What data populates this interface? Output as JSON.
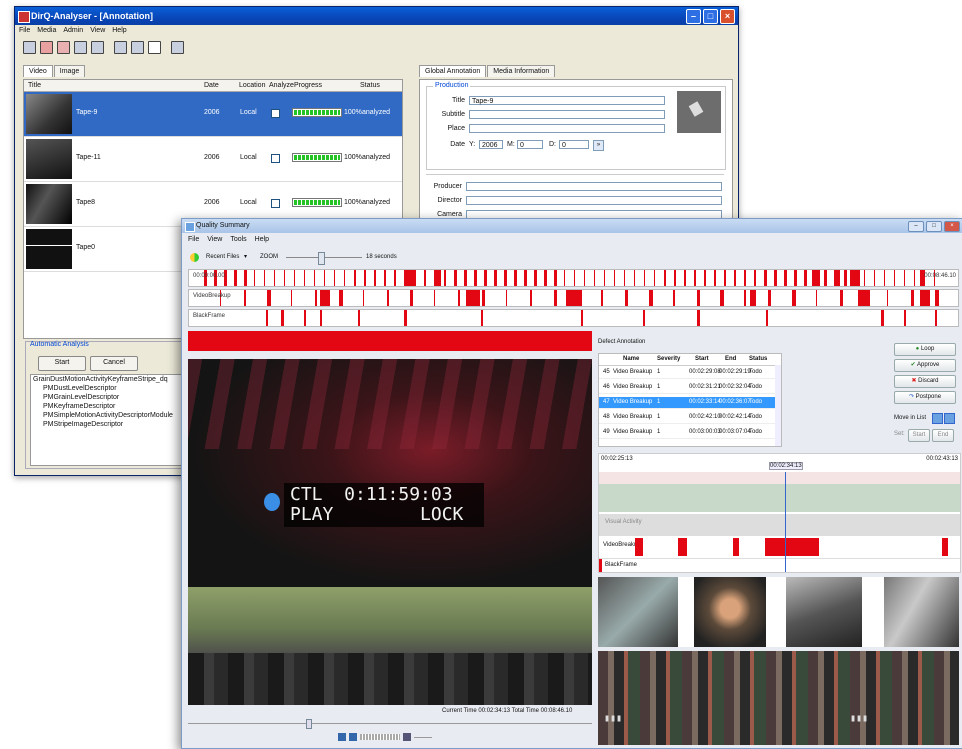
{
  "window_back": {
    "title": "DirQ-Analyser - [Annotation]",
    "menu": [
      "File",
      "Media",
      "Admin",
      "View",
      "Help"
    ],
    "left_tabs": [
      "Video",
      "Image"
    ],
    "columns": [
      "Title",
      "Date",
      "Location",
      "Analyze",
      "Progress",
      "Status"
    ],
    "rows": [
      {
        "title": "Tape-9",
        "date": "2006",
        "location": "Local",
        "progress_pct": 100,
        "progress_label": "100%",
        "status": "analyzed",
        "selected": true
      },
      {
        "title": "Tape-11",
        "date": "2006",
        "location": "Local",
        "progress_pct": 100,
        "progress_label": "100%",
        "status": "analyzed",
        "selected": false
      },
      {
        "title": "Tape8",
        "date": "2006",
        "location": "Local",
        "progress_pct": 100,
        "progress_label": "100%",
        "status": "analyzed",
        "selected": false
      },
      {
        "title": "Tape0",
        "date": "",
        "location": "",
        "progress_pct": 0,
        "progress_label": "",
        "status": "",
        "selected": false
      }
    ],
    "automatic_analysis": {
      "label": "Automatic Analysis",
      "start": "Start",
      "cancel": "Cancel",
      "tree_root": "GrainDustMotionActivityKeyframeStripe_dq",
      "tree_items": [
        "PMDustLevelDescriptor",
        "PMGrainLevelDescriptor",
        "PMKeyframeDescriptor",
        "PMSimpleMotionActivityDescriptorModule",
        "PMStripeImageDescriptor"
      ]
    },
    "right_tabs": [
      "Global Annotation",
      "Media Information"
    ],
    "production": {
      "label": "Production",
      "title_label": "Title",
      "title_value": "Tape-9",
      "subtitle_label": "Subtitle",
      "place_label": "Place",
      "date_label": "Date",
      "y_label": "Y:",
      "y_value": "2006",
      "m_label": "M:",
      "m_value": "0",
      "d_label": "D:",
      "d_value": "0",
      "producer_label": "Producer",
      "director_label": "Director",
      "camera_label": "Camera"
    }
  },
  "window_front": {
    "title": "Quality Summary",
    "menu": [
      "File",
      "View",
      "Tools",
      "Help"
    ],
    "toolbar": {
      "recent_files": "Recent Files",
      "zoom_label": "ZOOM",
      "zoom_value": "18 seconds"
    },
    "timeline_tracks": [
      {
        "label": ""
      },
      {
        "label": "VideoBreakup"
      },
      {
        "label": "BlackFrame"
      }
    ],
    "timeline_start": "00:00:00.00",
    "timeline_end": "00:08:46.10",
    "defect_annotation": {
      "title": "Defect Annotation",
      "columns": [
        "Name",
        "Severity",
        "Start",
        "End",
        "Status"
      ],
      "rows": [
        {
          "n": "45",
          "name": "Video Breakup",
          "severity": "1",
          "start": "00:02:29:08",
          "end": "00:02:29:19",
          "status": "Todo",
          "selected": false
        },
        {
          "n": "46",
          "name": "Video Breakup",
          "severity": "1",
          "start": "00:02:31:21",
          "end": "00:02:32:04",
          "status": "Todo",
          "selected": false
        },
        {
          "n": "47",
          "name": "Video Breakup",
          "severity": "1",
          "start": "00:02:33:14",
          "end": "00:02:36:07",
          "status": "Todo",
          "selected": true
        },
        {
          "n": "48",
          "name": "Video Breakup",
          "severity": "1",
          "start": "00:02:42:10",
          "end": "00:02:42:14",
          "status": "Todo",
          "selected": false
        },
        {
          "n": "49",
          "name": "Video Breakup",
          "severity": "1",
          "start": "00:03:00:03",
          "end": "00:03:07:04",
          "status": "Todo",
          "selected": false
        }
      ],
      "buttons": {
        "loop": "Loop",
        "approve": "Approve",
        "discard": "Discard",
        "postpone": "Postpone",
        "move_in_list": "Move in List",
        "set": "Set:",
        "start": "Start",
        "end": "End"
      }
    },
    "zoom_timeline": {
      "start": "00:02:25:13",
      "cursor": "00:02:34:13",
      "end": "00:02:43:13",
      "tracks": [
        "Visual Activity",
        "VideoBreakup",
        "BlackFrame"
      ]
    },
    "video_overlay": {
      "line1": "CTL  0:11:59:03",
      "line2": "PLAY        LOCK"
    },
    "status": {
      "current_label": "Current Time",
      "current": "00:02:34:13",
      "total_label": "Total Time",
      "total": "00:08:46.10"
    }
  },
  "colors": {
    "defect": "#e30613",
    "selection": "#3399ff",
    "xp_title": "#0a5fd8",
    "progress": "#23c423"
  }
}
